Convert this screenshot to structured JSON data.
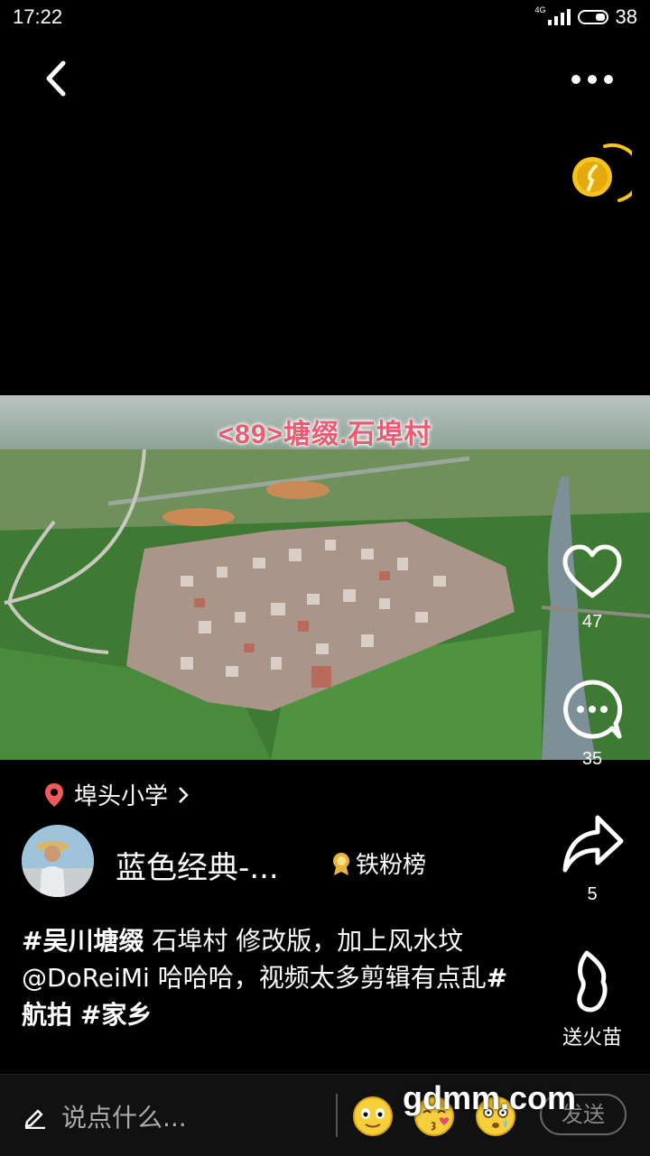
{
  "status_bar": {
    "time": "17:22",
    "network": "4G",
    "battery": "38"
  },
  "video": {
    "title": "<89>塘缀.石埠村"
  },
  "actions": {
    "like_count": "47",
    "comment_count": "35",
    "share_count": "5",
    "fire_label": "送火苗"
  },
  "location": {
    "name": "埠头小学"
  },
  "author": {
    "name": "蓝色经典-...",
    "fan_board": "铁粉榜"
  },
  "caption": {
    "tag1": "#吴川塘缀",
    "text1": " 石埠村 修改版，加上风水坟@DoReiMi 哈哈哈，视频太多剪辑有点乱",
    "tag2": "#航拍",
    "tag3": "#家乡"
  },
  "comment_bar": {
    "placeholder": "说点什么...",
    "send_label": "发送"
  },
  "watermark": "gdmm.com",
  "colors": {
    "title_pink": "#e85d73",
    "location_pin": "#f05a5a",
    "coin_gold": "#f7c31d"
  }
}
